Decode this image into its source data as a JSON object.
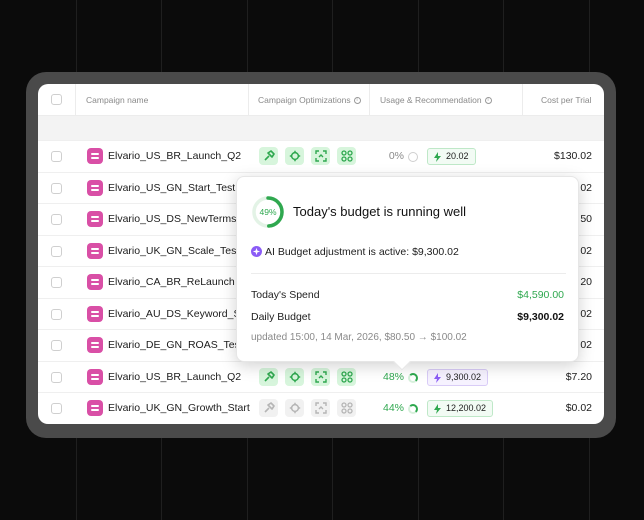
{
  "colors": {
    "accent_green": "#2fa84f",
    "pink": "#d94fa6",
    "violet": "#8b5cf6"
  },
  "header": {
    "col_campaign": "Campaign name",
    "col_optimizations": "Campaign Optimizations",
    "col_usage": "Usage & Recommendation",
    "col_cost": "Cost per Trial"
  },
  "rows": [
    {
      "name": "Elvario_US_BR_Launch_Q2",
      "opts": "on",
      "pct": "0%",
      "pct_state": "empty",
      "rec": "20.02",
      "rec_style": "green",
      "cost": "$130.02"
    },
    {
      "name": "Elvario_US_GN_Start_Test",
      "cost": "02"
    },
    {
      "name": "Elvario_US_DS_NewTerms",
      "cost": "50"
    },
    {
      "name": "Elvario_UK_GN_Scale_Test",
      "cost": "02"
    },
    {
      "name": "Elvario_CA_BR_ReLaunch",
      "cost": "20"
    },
    {
      "name": "Elvario_AU_DS_Keyword_St",
      "cost": "02"
    },
    {
      "name": "Elvario_DE_GN_ROAS_Test",
      "cost": "02"
    },
    {
      "name": "Elvario_US_BR_Launch_Q2",
      "opts": "on",
      "pct": "48%",
      "pct_state": "partial",
      "rec": "9,300.02",
      "rec_style": "violet",
      "cost": "$7.20"
    },
    {
      "name": "Elvario_UK_GN_Growth_Start",
      "opts": "off",
      "pct": "44%",
      "pct_state": "partial",
      "rec": "12,200.02",
      "rec_style": "green",
      "cost": "$0.02"
    }
  ],
  "popover": {
    "progress": "49%",
    "progress_value": 49,
    "title": "Today's budget is running well",
    "ai_text": "AI Budget adjustment is active: $9,300.02",
    "spend_label": "Today's Spend",
    "spend_value": "$4,590.00",
    "budget_label": "Daily Budget",
    "budget_value": "$9,300.02",
    "updated": "updated 15:00, 14 Mar, 2026, $80.50 → $100.02"
  }
}
